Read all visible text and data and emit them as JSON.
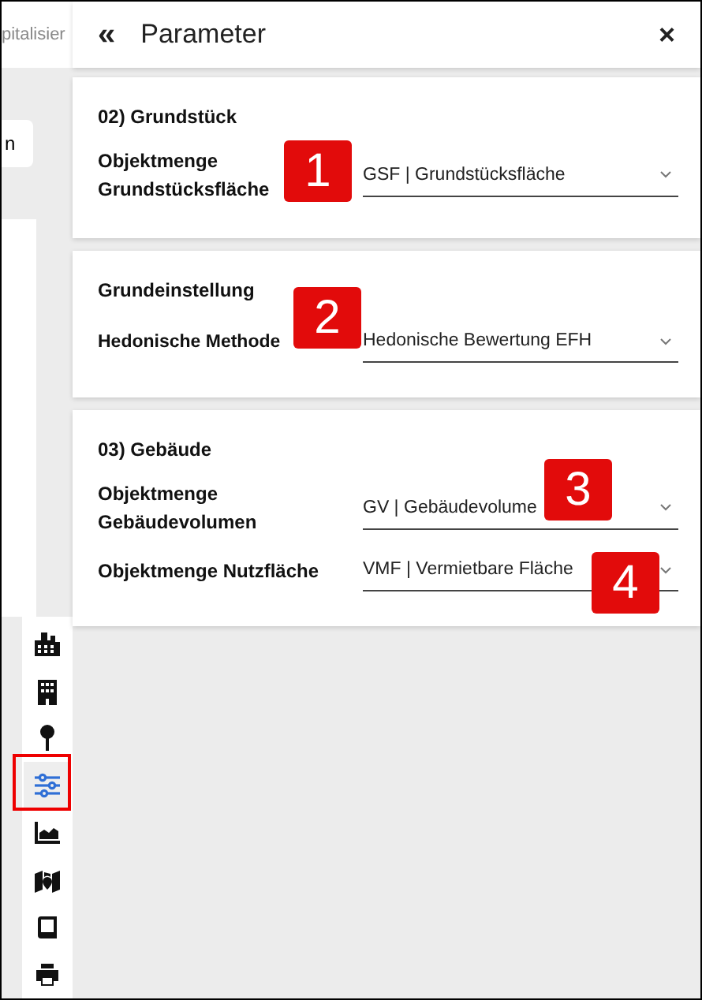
{
  "background": {
    "tab_text": "pitalisier",
    "button_text": "n"
  },
  "panel": {
    "title": "Parameter",
    "collapse_icon": "«",
    "close_icon": "×"
  },
  "sections": [
    {
      "title": "02) Grundstück",
      "fields": [
        {
          "label": "Objektmenge Grundstücksfläche",
          "value": "GSF | Grundstücksfläche"
        }
      ]
    },
    {
      "title": "Grundeinstellung",
      "fields": [
        {
          "label": "Hedonische Methode",
          "value": "Hedonische Bewertung EFH"
        }
      ]
    },
    {
      "title": "03) Gebäude",
      "fields": [
        {
          "label": "Objektmenge Gebäudevolumen",
          "value": "GV | Gebäudevolume"
        },
        {
          "label": "Objektmenge Nutzfläche",
          "value": "VMF | Vermietbare Fläche"
        }
      ]
    }
  ],
  "sidebar": [
    {
      "kind": "industry",
      "selected": false
    },
    {
      "kind": "building",
      "selected": false
    },
    {
      "kind": "pin",
      "selected": false
    },
    {
      "kind": "sliders",
      "selected": true
    },
    {
      "kind": "chart",
      "selected": false
    },
    {
      "kind": "map",
      "selected": false
    },
    {
      "kind": "book",
      "selected": false
    },
    {
      "kind": "print",
      "selected": false
    }
  ],
  "markers": [
    {
      "number": "1"
    },
    {
      "number": "2"
    },
    {
      "number": "3"
    },
    {
      "number": "4"
    }
  ]
}
